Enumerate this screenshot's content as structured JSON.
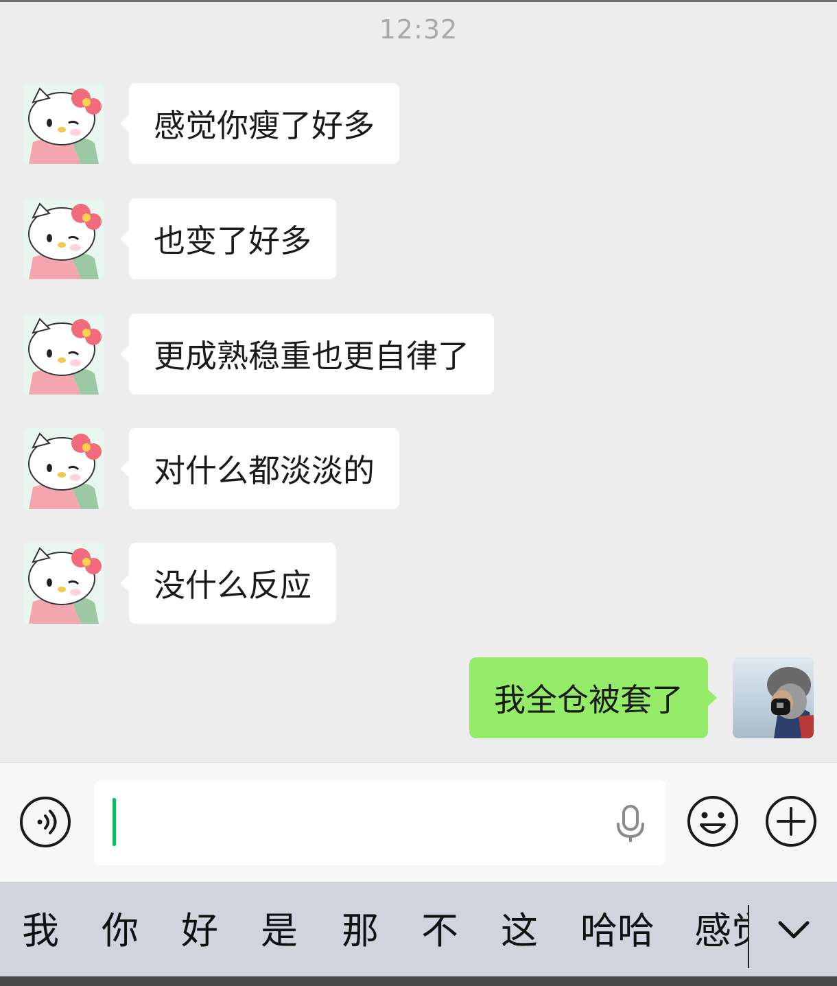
{
  "chat": {
    "timestamp": "12:32",
    "messages": [
      {
        "direction": "incoming",
        "text": "感觉你瘦了好多"
      },
      {
        "direction": "incoming",
        "text": "也变了好多"
      },
      {
        "direction": "incoming",
        "text": "更成熟稳重也更自律了"
      },
      {
        "direction": "incoming",
        "text": "对什么都淡淡的"
      },
      {
        "direction": "incoming",
        "text": "没什么反应"
      },
      {
        "direction": "outgoing",
        "text": "我全仓被套了"
      }
    ]
  },
  "input_bar": {
    "value": "",
    "icons": {
      "voice": "voice-toggle-icon",
      "mic": "microphone-icon",
      "emoji": "emoji-icon",
      "more": "plus-icon"
    }
  },
  "keyboard": {
    "candidates": [
      "我",
      "你",
      "好",
      "是",
      "那",
      "不",
      "这",
      "哈哈",
      "感觉"
    ],
    "expand_icon": "chevron-down-icon"
  },
  "colors": {
    "chat_background": "#ededed",
    "incoming_bubble": "#ffffff",
    "outgoing_bubble": "#95ec69",
    "caret": "#07c160",
    "candidate_bar": "#d1d4dd"
  }
}
